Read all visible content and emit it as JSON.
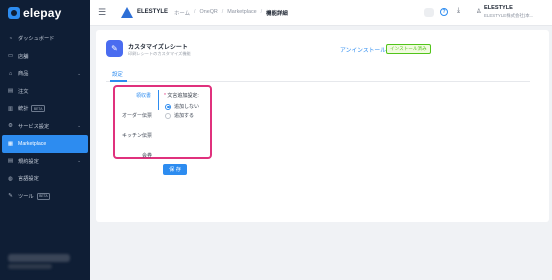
{
  "sidebar": {
    "logo": "elepay",
    "items": [
      {
        "label": "ダッシュボード",
        "icon": "dashboard-icon",
        "glyph": "◔",
        "active": false,
        "chevron": false,
        "badge": ""
      },
      {
        "label": "店舗",
        "icon": "store-icon",
        "glyph": "▭",
        "active": false,
        "chevron": false,
        "badge": ""
      },
      {
        "label": "商品",
        "icon": "tag-icon",
        "glyph": "⌂",
        "active": false,
        "chevron": true,
        "badge": ""
      },
      {
        "label": "注文",
        "icon": "order-icon",
        "glyph": "▤",
        "active": false,
        "chevron": false,
        "badge": ""
      },
      {
        "label": "統計",
        "icon": "chart-icon",
        "glyph": "▥",
        "active": false,
        "chevron": false,
        "badge": "BETA"
      },
      {
        "label": "サービス設定",
        "icon": "settings-icon",
        "glyph": "⚙",
        "active": false,
        "chevron": true,
        "badge": ""
      },
      {
        "label": "Marketplace",
        "icon": "marketplace-icon",
        "glyph": "▦",
        "active": true,
        "chevron": false,
        "badge": ""
      },
      {
        "label": "規約設定",
        "icon": "document-icon",
        "glyph": "▤",
        "active": false,
        "chevron": true,
        "badge": ""
      },
      {
        "label": "言語設定",
        "icon": "globe-icon",
        "glyph": "◍",
        "active": false,
        "chevron": false,
        "badge": ""
      },
      {
        "label": "ツール",
        "icon": "tool-icon",
        "glyph": "✎",
        "active": false,
        "chevron": false,
        "badge": "BETA"
      }
    ]
  },
  "header": {
    "brand": "ELESTYLE",
    "breadcrumb": [
      "ホーム",
      "OneQR",
      "Marketplace",
      "機能詳細"
    ],
    "user_name": "ELESTYLE",
    "user_company": "ELESTYLE株式会社(本..."
  },
  "app": {
    "title": "カスタマイズレシート",
    "description": "印刷レシートのカスタマイズ機能",
    "uninstall_label": "アンインストール",
    "installed_label": "インストール済み",
    "tab_label": "設定"
  },
  "settings": {
    "tabs": [
      "領収書",
      "オーダー伝票",
      "キッチン伝票",
      "会券"
    ],
    "field_label": "文言追加設定:",
    "options": [
      {
        "label": "追加しない",
        "checked": true
      },
      {
        "label": "追加する",
        "checked": false
      }
    ],
    "save_label": "保 存"
  },
  "colors": {
    "accent": "#2d8cf0",
    "sidebar_bg": "#0f1e35",
    "highlight": "#e0317d",
    "installed": "#52c41a"
  }
}
